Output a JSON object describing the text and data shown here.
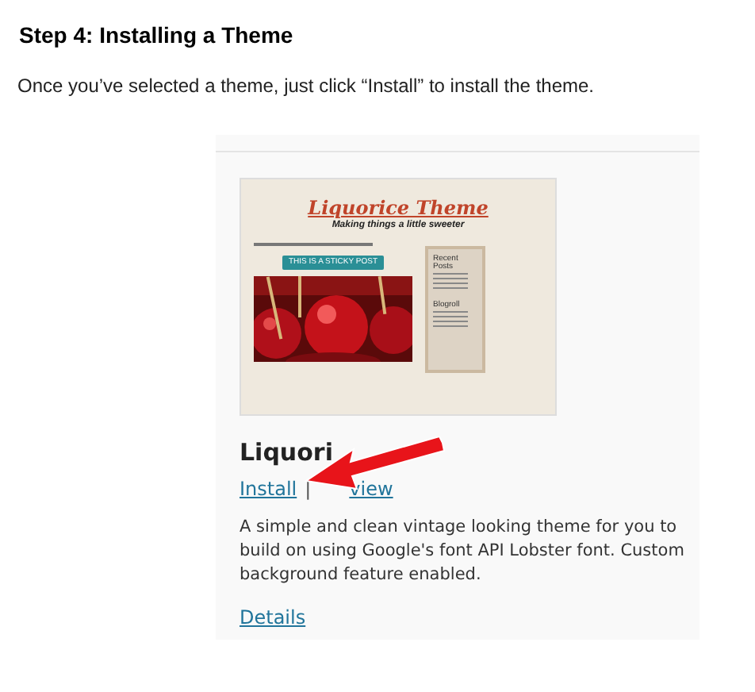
{
  "heading": "Step 4: Installing a Theme",
  "intro": "Once you’ve selected a theme, just click “Install” to install the theme.",
  "theme_card": {
    "preview": {
      "site_title": "Liquorice Theme",
      "tagline": "Making things a little sweeter",
      "sticky_button": "THIS IS A STICKY POST",
      "sidebar_headings": [
        "Recent Posts",
        "Blogroll"
      ]
    },
    "title": "Liquori",
    "links": [
      {
        "label": "Install"
      },
      {
        "label": "view"
      }
    ],
    "separator": "|",
    "description": "A simple and clean vintage looking theme for you to build on using Google's font API Lobster font. Custom background feature enabled.",
    "details_link": "Details"
  }
}
